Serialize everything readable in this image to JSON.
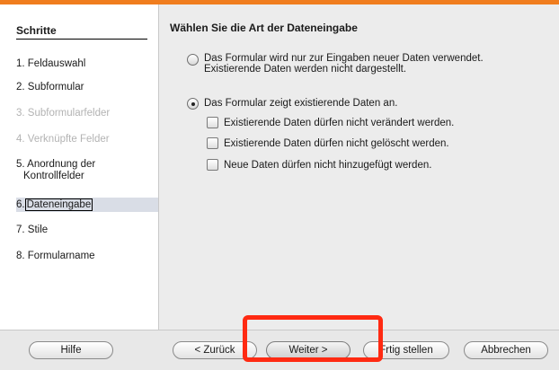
{
  "sidebar": {
    "title": "Schritte",
    "steps": [
      {
        "label": "1. Feldauswahl"
      },
      {
        "label": "2. Subformular"
      },
      {
        "label": "3. Subformularfelder"
      },
      {
        "label": "4. Verknüpfte Felder"
      },
      {
        "label_line1": "5. Anordnung der",
        "label_line2": "Kontrollfelder"
      },
      {
        "label_prefix": "6.",
        "label_boxed": "Dateneingabe"
      },
      {
        "label": "7. Stile"
      },
      {
        "label": "8. Formularname"
      }
    ]
  },
  "main": {
    "title": "Wählen Sie die Art der Dateneingabe",
    "radio1": {
      "line1": "Das Formular wird nur zur Eingaben neuer Daten verwendet.",
      "line2": "Existierende Daten werden nicht dargestellt.",
      "checked": false
    },
    "radio2": {
      "label": "Das Formular zeigt existierende Daten an.",
      "checked": true
    },
    "checkboxes": [
      {
        "label": "Existierende Daten dürfen nicht verändert werden.",
        "checked": false
      },
      {
        "label": "Existierende Daten dürfen nicht gelöscht werden.",
        "checked": false
      },
      {
        "label": "Neue Daten dürfen nicht hinzugefügt werden.",
        "checked": false
      }
    ]
  },
  "buttons": {
    "help": "Hilfe",
    "back": "< Zurück",
    "next": "Weiter >",
    "finish_prefix": "F",
    "finish_rest": "rtig stellen",
    "cancel": "Abbrechen"
  },
  "colors": {
    "top_accent": "#f07d1e",
    "highlight_box": "#ff2a12",
    "active_step_bg": "#d9dde6"
  }
}
